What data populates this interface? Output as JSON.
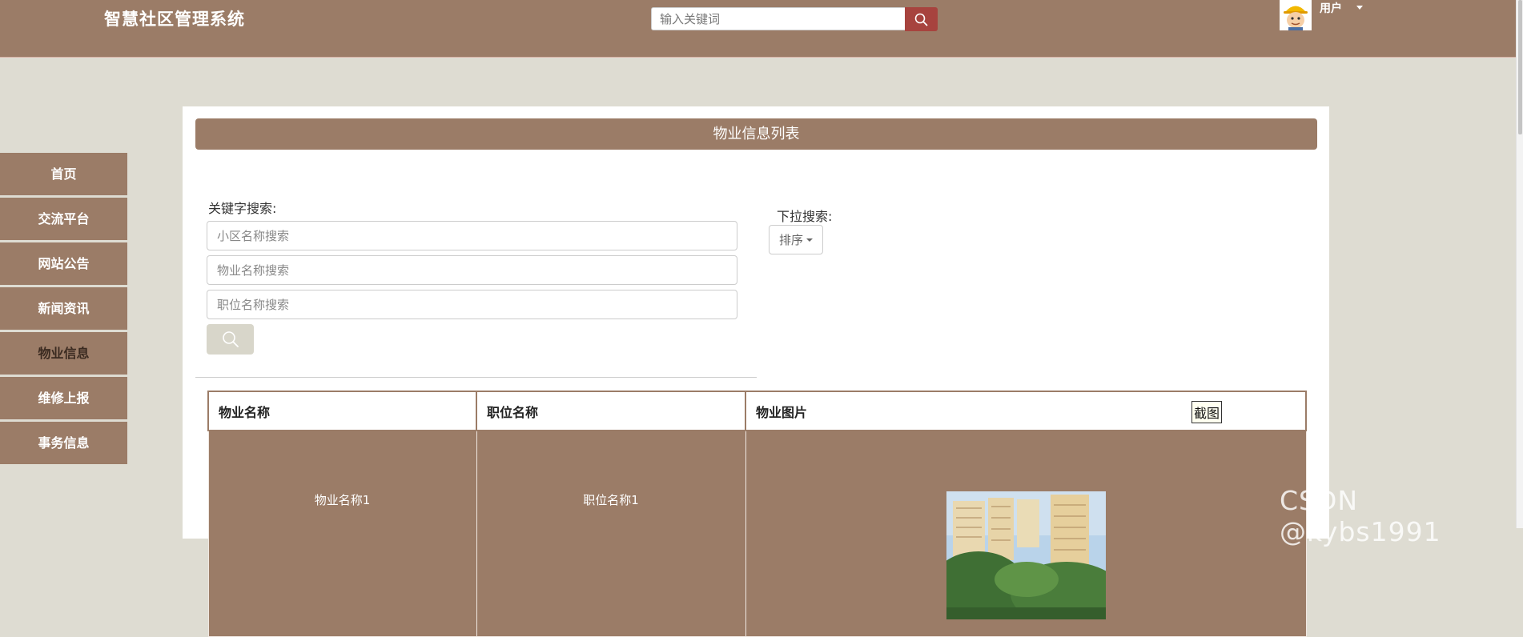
{
  "header": {
    "site_title": "智慧社区管理系统",
    "search_placeholder": "输入关键词",
    "user_label": "用户"
  },
  "sidebar": {
    "items": [
      {
        "label": "首页"
      },
      {
        "label": "交流平台"
      },
      {
        "label": "网站公告"
      },
      {
        "label": "新闻资讯"
      },
      {
        "label": "物业信息",
        "active": true
      },
      {
        "label": "维修上报"
      },
      {
        "label": "事务信息"
      }
    ]
  },
  "panel": {
    "title": "物业信息列表",
    "keyword_search_label": "关键字搜索:",
    "inputs": {
      "community_placeholder": "小区名称搜索",
      "property_placeholder": "物业名称搜索",
      "position_placeholder": "职位名称搜索"
    },
    "dropdown_search_label": "下拉搜索:",
    "sort_label": "排序"
  },
  "table": {
    "columns": [
      "物业名称",
      "职位名称",
      "物业图片"
    ],
    "screenshot_tag": "截图",
    "rows": [
      {
        "property_name": "物业名称1",
        "position_name": "职位名称1"
      }
    ]
  },
  "watermark": "CSDN @kybs1991",
  "colors": {
    "brand": "#9b7c67",
    "search_button": "#a7433e",
    "page_bg": "#dedcd2"
  },
  "icons": {
    "search": "magnifier",
    "user_avatar": "cartoon-worker"
  }
}
